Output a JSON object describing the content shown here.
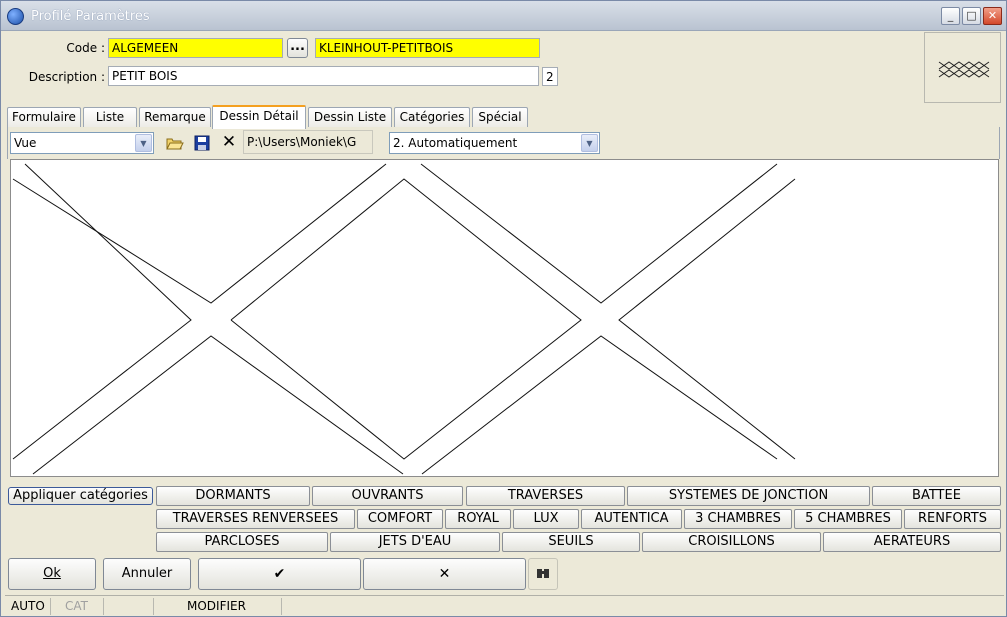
{
  "window": {
    "title": "Profilé Paramètres"
  },
  "form": {
    "code_label": "Code :",
    "code_value": "ALGEMEEN",
    "browse_label": "...",
    "code_name": "KLEINHOUT-PETITBOIS",
    "description_label": "Description :",
    "description_value": "PETIT BOIS",
    "description_count": "2"
  },
  "tabs": [
    "Formulaire",
    "Liste",
    "Remarque",
    "Dessin Détail",
    "Dessin Liste",
    "Catégories",
    "Spécial"
  ],
  "active_tab": "Dessin Détail",
  "toolbar": {
    "view_select": "Vue",
    "path": "P:\\Users\\Moniek\\G",
    "mode_select": "2.  Automatiquement"
  },
  "categories": {
    "apply_label": "Appliquer catégories",
    "row1": [
      "DORMANTS",
      "OUVRANTS",
      "TRAVERSES",
      "SYSTEMES DE JONCTION",
      "BATTEE"
    ],
    "row2": [
      "TRAVERSES RENVERSEES",
      "COMFORT",
      "ROYAL",
      "LUX",
      "AUTENTICA",
      "3 CHAMBRES",
      "5 CHAMBRES",
      "RENFORTS"
    ],
    "row3": [
      "PARCLOSES",
      "JETS D'EAU",
      "SEUILS",
      "CROISILLONS",
      "AERATEURS"
    ]
  },
  "actions": {
    "ok": "Ok",
    "cancel": "Annuler",
    "confirm_symbol": "✔",
    "reject_symbol": "✕"
  },
  "statusbar": {
    "mode": "AUTO",
    "cat": "CAT",
    "blank": "",
    "state": "MODIFIER"
  },
  "colors": {
    "highlight": "#ffff00",
    "active_tab": "#f4a020"
  }
}
